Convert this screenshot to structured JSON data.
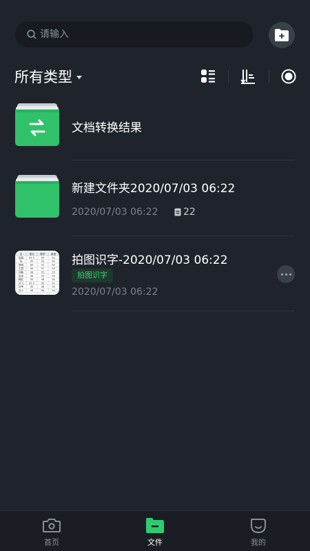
{
  "search": {
    "placeholder": "请输入"
  },
  "filter": {
    "type_label": "所有类型"
  },
  "items": [
    {
      "title": "文档转换结果",
      "icon": "folder-convert-icon"
    },
    {
      "title": "新建文件夹2020/07/03 06:22",
      "date": "2020/07/03 06:22",
      "count": "22",
      "icon": "folder-icon"
    },
    {
      "title": "拍图识字-2020/07/03 06:22",
      "tag": "拍图识字",
      "date": "2020/07/03 06:22",
      "icon": "table-image-thumbnail"
    }
  ],
  "ocr_table": {
    "headers": [
      "名",
      "语文",
      "数学",
      "英语"
    ],
    "rows": [
      [
        "张朋",
        "95.5",
        "94",
        "92"
      ],
      [
        "张",
        "95",
        "93",
        "90"
      ],
      [
        "李明",
        "89",
        "97",
        "90"
      ],
      [
        "王霞",
        "90",
        "97",
        "93"
      ],
      [
        "刘敏",
        "98",
        "95",
        "95"
      ],
      [
        "张伟",
        "98",
        "93",
        "90"
      ],
      [
        "韩红",
        "95",
        "96",
        "94"
      ],
      [
        "孙飞",
        "95.5",
        "95",
        "91"
      ],
      [
        "孙学",
        "95",
        "98",
        "94"
      ],
      [
        "白小",
        "98",
        "96",
        "94"
      ]
    ]
  },
  "nav": [
    {
      "label": "首页",
      "icon": "camera-icon"
    },
    {
      "label": "文件",
      "icon": "folder-icon"
    },
    {
      "label": "我的",
      "icon": "profile-icon"
    }
  ],
  "colors": {
    "background": "#1f242c",
    "accent": "#2ecc71",
    "text_secondary": "#7d838a"
  }
}
